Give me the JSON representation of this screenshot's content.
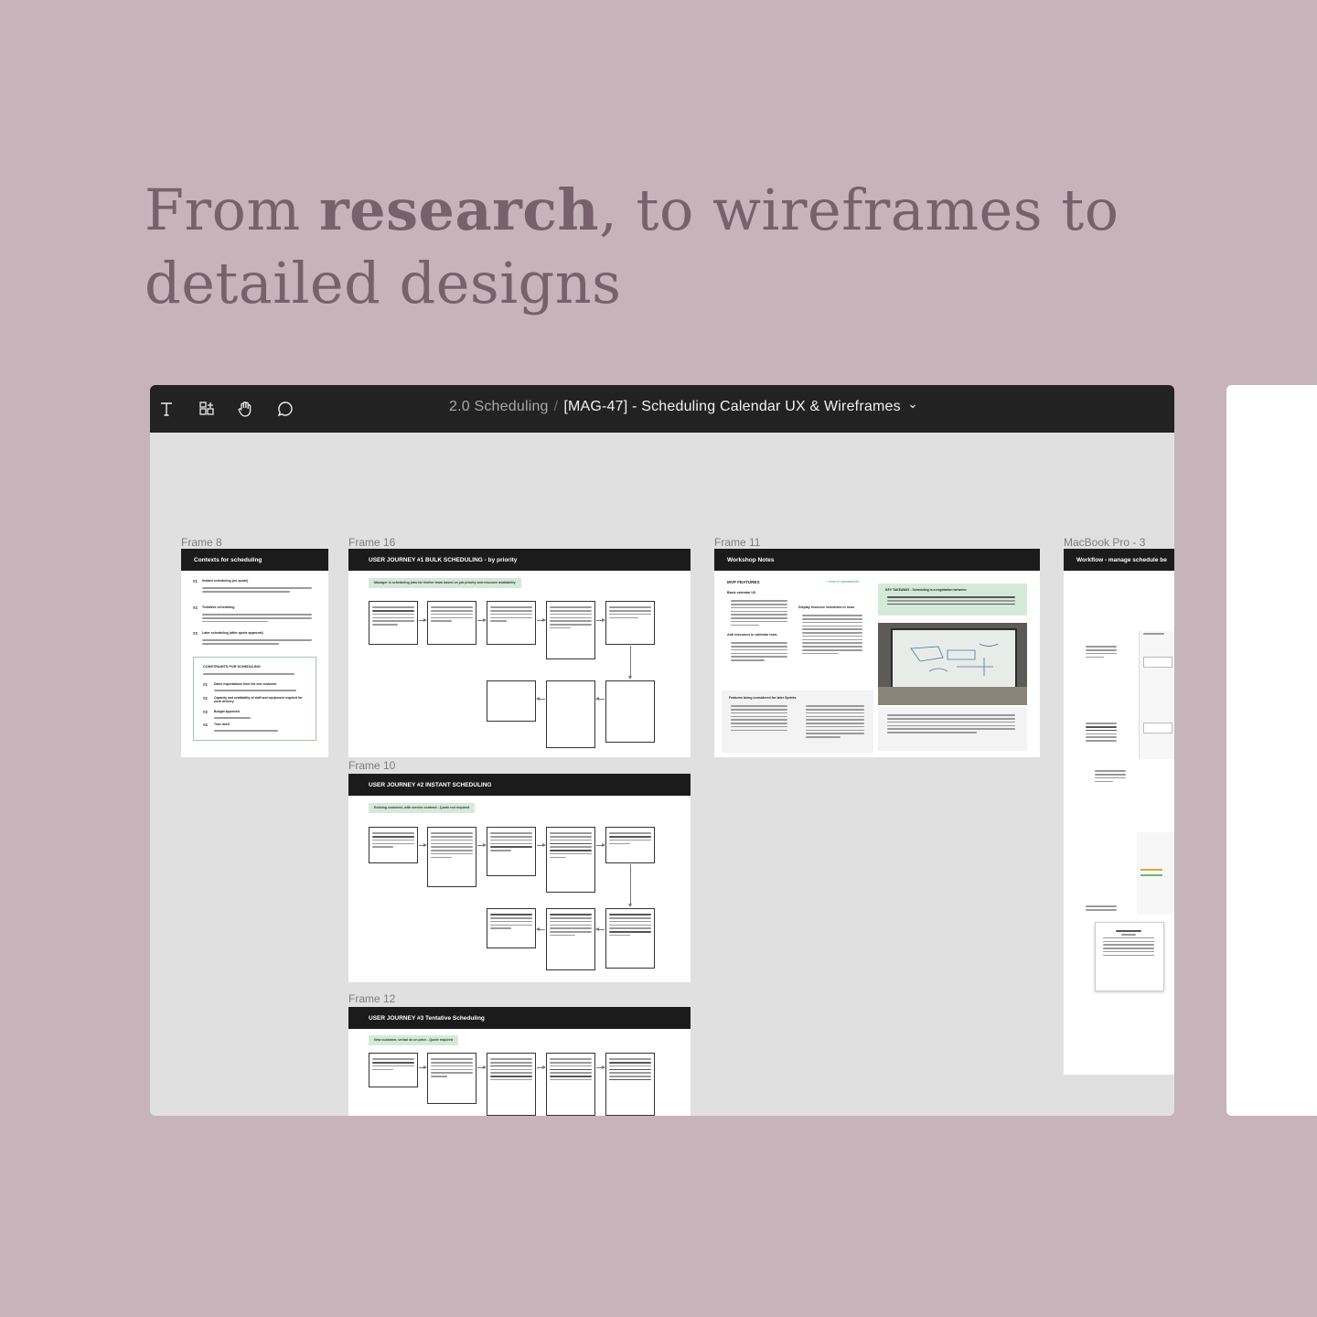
{
  "headline": {
    "part1": "From ",
    "emphasis": "research",
    "part2": ", to wireframes to detailed designs"
  },
  "toolbar": {
    "tools": [
      {
        "name": "text-tool-icon"
      },
      {
        "name": "components-icon"
      },
      {
        "name": "hand-tool-icon"
      },
      {
        "name": "comment-icon"
      }
    ]
  },
  "breadcrumb": {
    "parent": "2.0 Scheduling",
    "separator": "/",
    "current": "[MAG-47] - Scheduling Calendar UX & Wireframes"
  },
  "frames": {
    "frame8": {
      "label": "Frame 8",
      "header": "Contexts for scheduling",
      "items": [
        {
          "num": "#1",
          "title": "Instant scheduling (no quote)"
        },
        {
          "num": "#2",
          "title": "Tentative scheduling"
        },
        {
          "num": "#3",
          "title": "Later scheduling (after quote approval)"
        }
      ],
      "constraints_title": "CONSTRAINTS FOR SCHEDULING",
      "constraints": [
        {
          "num": "#1",
          "title": "Dates expectations from the end customer"
        },
        {
          "num": "#2",
          "title": "Capacity and availability of staff and equipment required for work delivery"
        },
        {
          "num": "#3",
          "title": "Budget approved"
        },
        {
          "num": "#4",
          "title": "Time itself"
        }
      ]
    },
    "frame16": {
      "label": "Frame 16",
      "header": "USER JOURNEY #1 BULK SCHEDULING - by priority",
      "tag": "Manager is scheduling jobs for his/her team based on job priority and resource availability"
    },
    "frame10": {
      "label": "Frame 10",
      "header": "USER JOURNEY #2 INSTANT SCHEDULING",
      "tag": "Existing customer, with service contract - Quote not required"
    },
    "frame12": {
      "label": "Frame 12",
      "header": "USER JOURNEY #3 Tentative Scheduling",
      "tag": "New customer, verbal ok on price - Quote required"
    },
    "frame11": {
      "label": "Frame 11",
      "header": "Workshop Notes",
      "mvp_title": "MVP FEATURES",
      "mvp_link": "+ more in spreadsheet",
      "col1_title": "Basic calendar UX",
      "col2_title": "Display resource schedules in rows",
      "col3_title": "Add resources in calendar rows",
      "later_title": "Features being considered for later Sprints",
      "takeaway": "KEY TAKEAWAY - Scheduling is a negotiation between:"
    },
    "macbook3": {
      "label": "MacBook Pro - 3",
      "header": "Workflow - manage schedule be"
    }
  }
}
